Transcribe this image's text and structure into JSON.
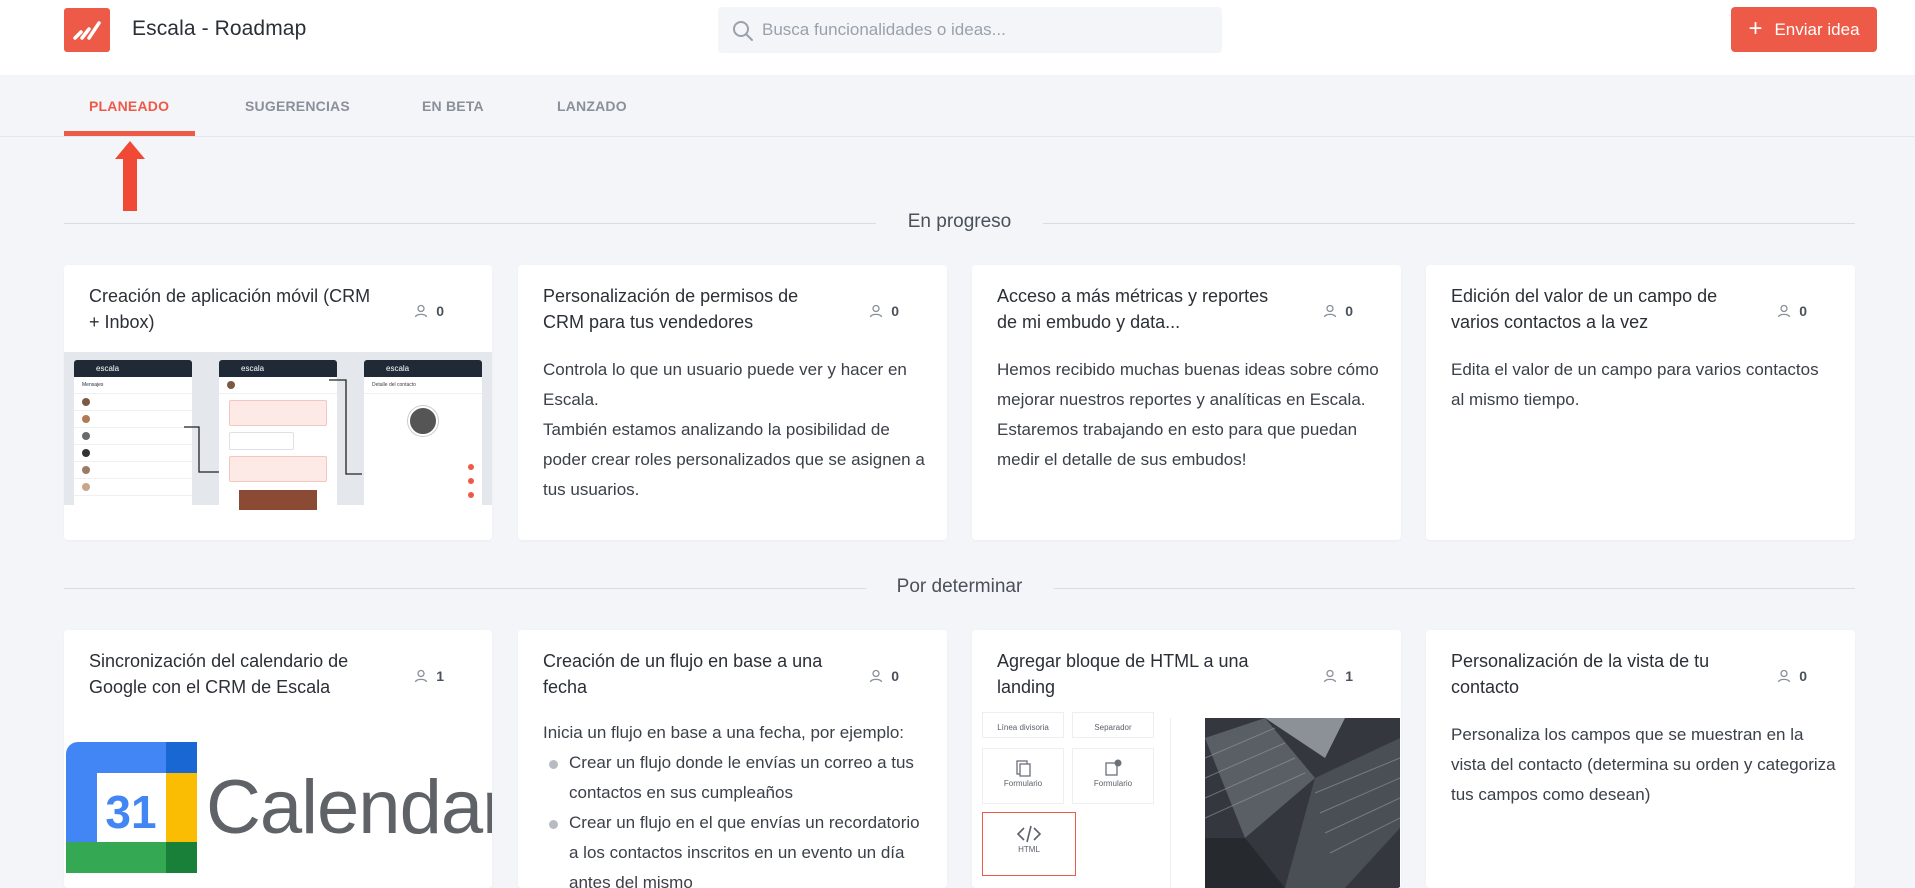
{
  "header": {
    "app_title": "Escala - Roadmap",
    "search_placeholder": "Busca funcionalidades o ideas...",
    "submit_label": "Enviar idea",
    "brand_color": "#ee5a48"
  },
  "tabs": [
    {
      "label": "PLANEADO",
      "active": true
    },
    {
      "label": "SUGERENCIAS",
      "active": false
    },
    {
      "label": "EN BETA",
      "active": false
    },
    {
      "label": "LANZADO",
      "active": false
    }
  ],
  "sections": [
    {
      "label": "En progreso",
      "cards": [
        {
          "title": "Creación de aplicación móvil (CRM + Inbox)",
          "votes": "0",
          "image": "mobile-app-mockups",
          "mock_text": {
            "brand": "escala",
            "inbox": "Mensajes",
            "detail": "Detalle del contacto"
          }
        },
        {
          "title": "Personalización de permisos de CRM para tus vendedores",
          "votes": "0",
          "desc": [
            "Controla lo que un usuario puede ver y hacer en Escala.",
            "También estamos analizando la posibilidad de poder crear roles personalizados que se asignen a tus usuarios."
          ]
        },
        {
          "title": "Acceso a más métricas y reportes de mi embudo y data...",
          "votes": "0",
          "desc": [
            "Hemos recibido muchas buenas ideas sobre cómo mejorar nuestros reportes y analíticas en Escala. Estaremos trabajando en esto para que puedan medir el detalle de sus embudos!"
          ]
        },
        {
          "title": "Edición del valor de un campo de varios contactos a la vez",
          "votes": "0",
          "desc": [
            "Edita el valor de un campo para varios contactos al mismo tiempo."
          ]
        }
      ]
    },
    {
      "label": "Por determinar",
      "cards": [
        {
          "title": "Sincronización del calendario de Google con el CRM de Escala",
          "votes": "1",
          "image": "google-calendar-logo",
          "logo_day": "31",
          "logo_word": "Calendar"
        },
        {
          "title": "Creación de un flujo en base a una fecha",
          "votes": "0",
          "intro": "Inicia un flujo en base a una fecha, por ejemplo:",
          "bullets": [
            "Crear un flujo donde le envías un correo a tus contactos en sus cumpleaños",
            "Crear un flujo en el que envías un recordatorio a los contactos inscritos en un evento un día antes del mismo"
          ]
        },
        {
          "title": "Agregar bloque de HTML a una landing",
          "votes": "1",
          "image": "html-block-builder",
          "tiles": [
            "Línea divisoria",
            "Separador",
            "Formulario",
            "Formulario",
            "HTML"
          ]
        },
        {
          "title": "Personalización de la vista de tu contacto",
          "votes": "0",
          "desc": [
            "Personaliza los campos que se muestran en la vista del contacto (determina su orden y categoriza tus campos como desean)"
          ]
        }
      ]
    }
  ]
}
